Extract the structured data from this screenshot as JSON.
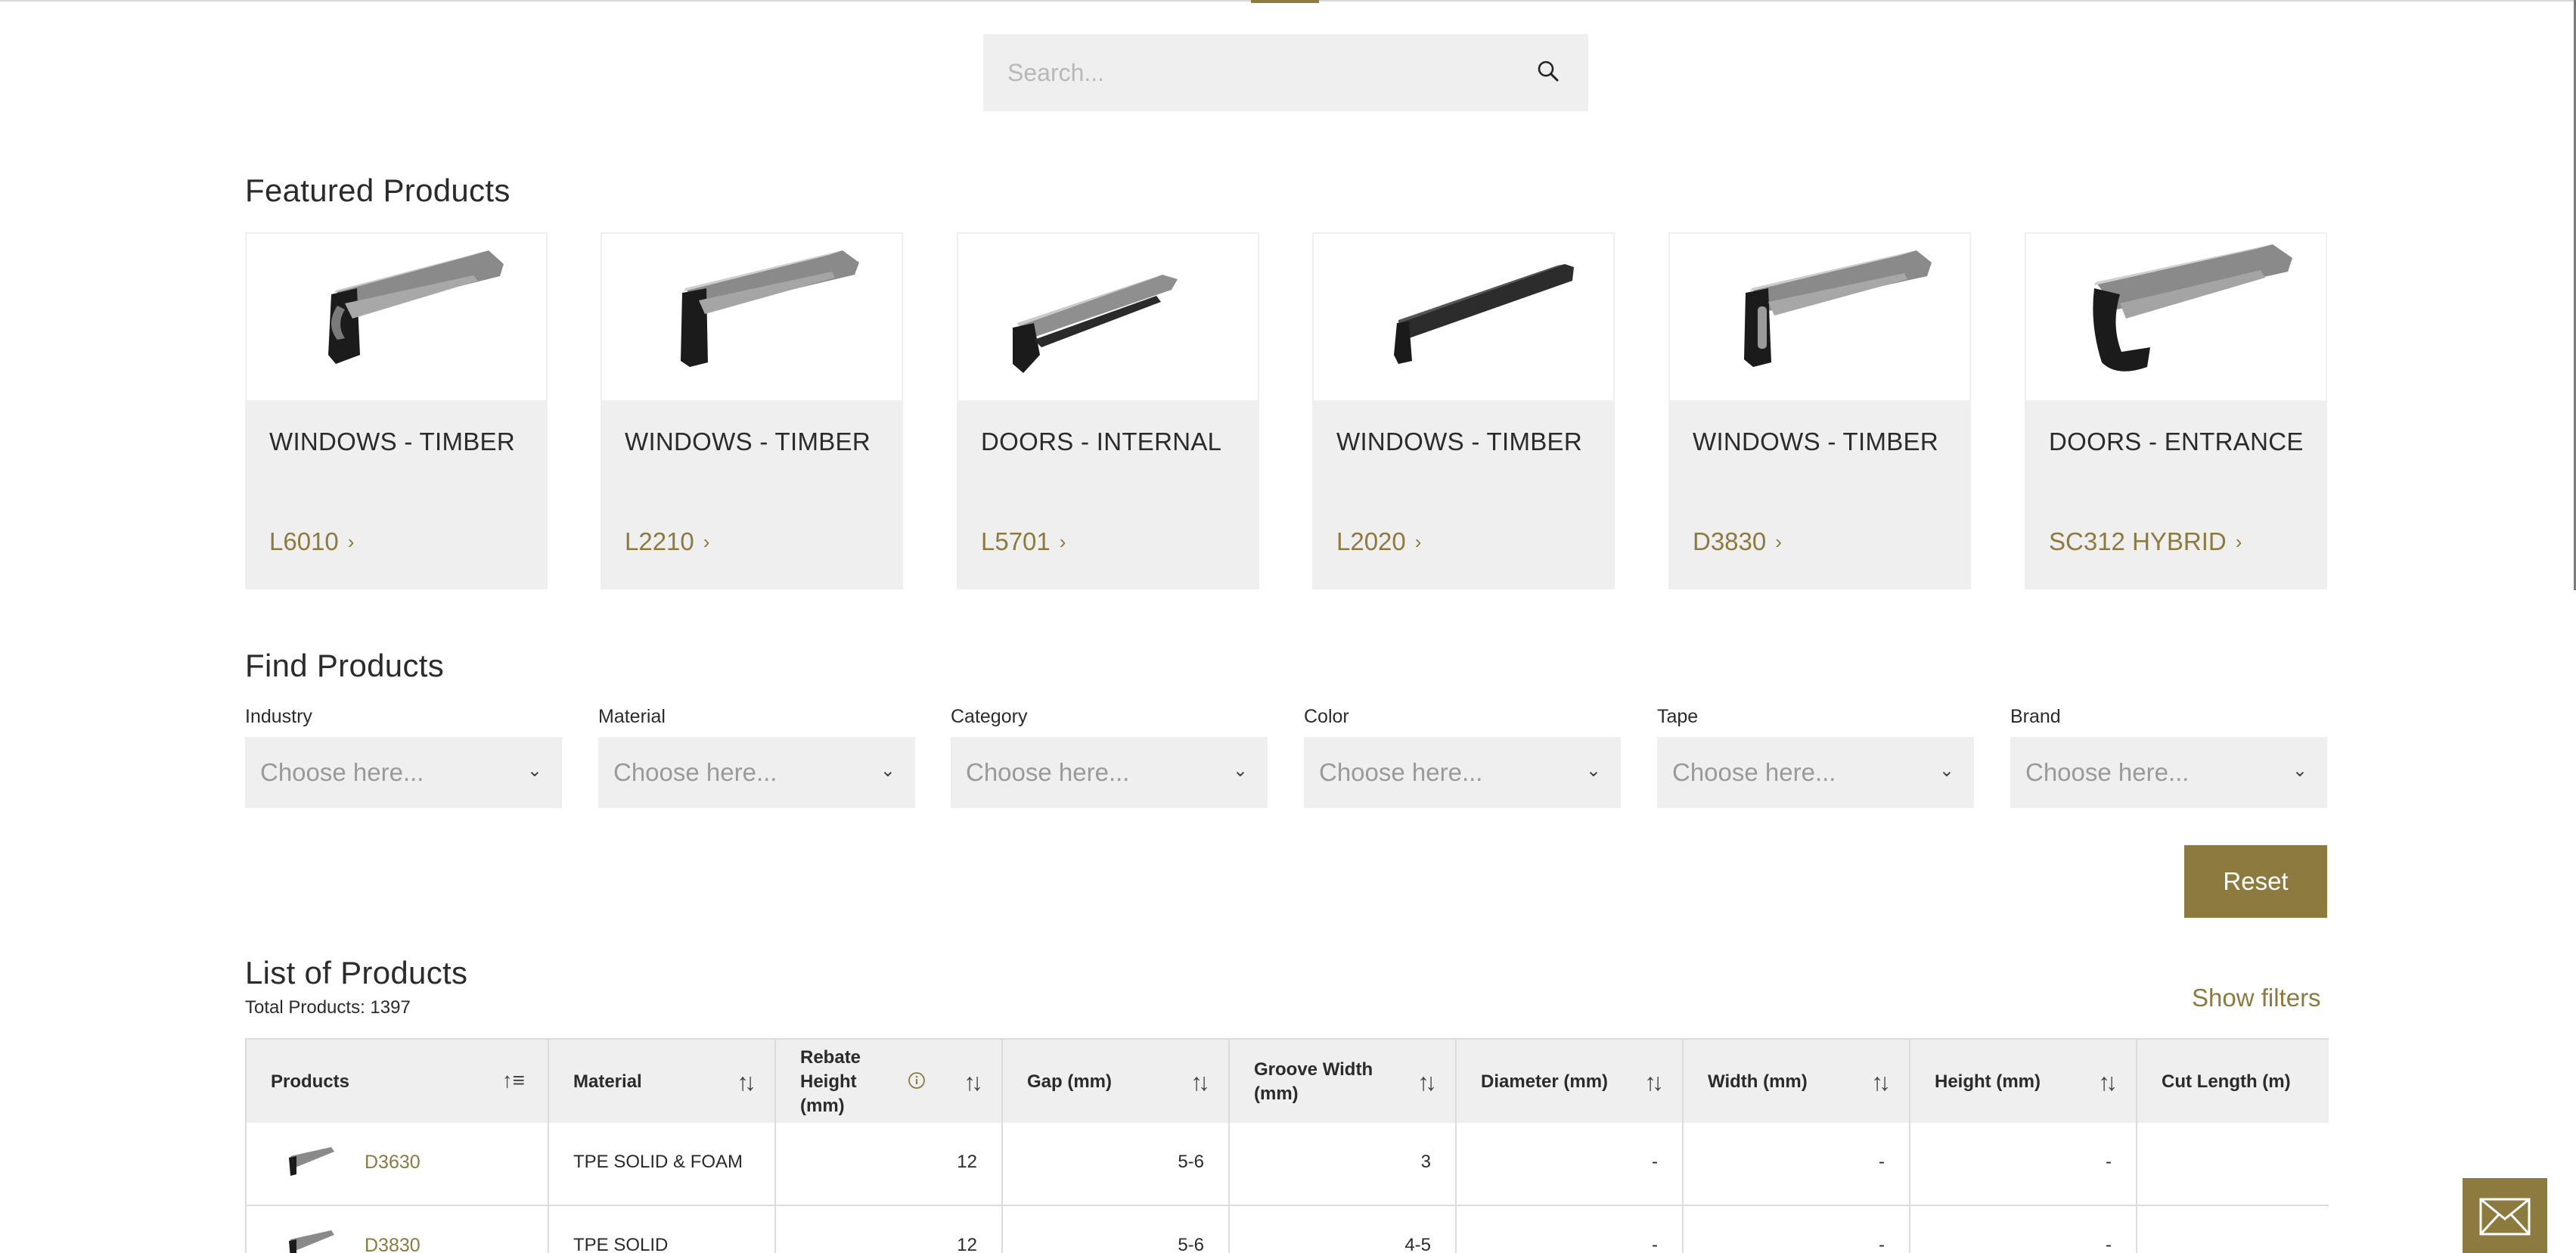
{
  "search": {
    "placeholder": "Search..."
  },
  "featured": {
    "title": "Featured Products",
    "cards": [
      {
        "category": "WINDOWS - TIMBER",
        "code": "L6010"
      },
      {
        "category": "WINDOWS - TIMBER",
        "code": "L2210"
      },
      {
        "category": "DOORS - INTERNAL",
        "code": "L5701"
      },
      {
        "category": "WINDOWS - TIMBER",
        "code": "L2020"
      },
      {
        "category": "WINDOWS - TIMBER",
        "code": "D3830"
      },
      {
        "category": "DOORS - ENTRANCE",
        "code": "SC312 HYBRID"
      }
    ],
    "chevron": "›"
  },
  "find": {
    "title": "Find Products",
    "filters": [
      {
        "label": "Industry",
        "value": "Choose here..."
      },
      {
        "label": "Material",
        "value": "Choose here..."
      },
      {
        "label": "Category",
        "value": "Choose here..."
      },
      {
        "label": "Color",
        "value": "Choose here..."
      },
      {
        "label": "Tape",
        "value": "Choose here..."
      },
      {
        "label": "Brand",
        "value": "Choose here..."
      }
    ],
    "reset_label": "Reset"
  },
  "list": {
    "title": "List of Products",
    "total": "Total Products: 1397",
    "show_filters": "Show filters",
    "columns": [
      "Products",
      "Material",
      "Rebate Height (mm)",
      "Gap (mm)",
      "Groove Width (mm)",
      "Diameter (mm)",
      "Width (mm)",
      "Height (mm)",
      "Cut Length (m)"
    ],
    "rows": [
      {
        "product": "D3630",
        "material": "TPE SOLID & FOAM",
        "rebate": "12",
        "gap": "5-6",
        "groove": "3",
        "diameter": "-",
        "width": "-",
        "height": "-",
        "cut": ""
      },
      {
        "product": "D3830",
        "material": "TPE SOLID",
        "rebate": "12",
        "gap": "5-6",
        "groove": "4-5",
        "diameter": "-",
        "width": "-",
        "height": "-",
        "cut": ""
      }
    ]
  },
  "colors": {
    "accent": "#8c7a3f",
    "panel": "#efefef",
    "border": "#dcdcdc"
  }
}
